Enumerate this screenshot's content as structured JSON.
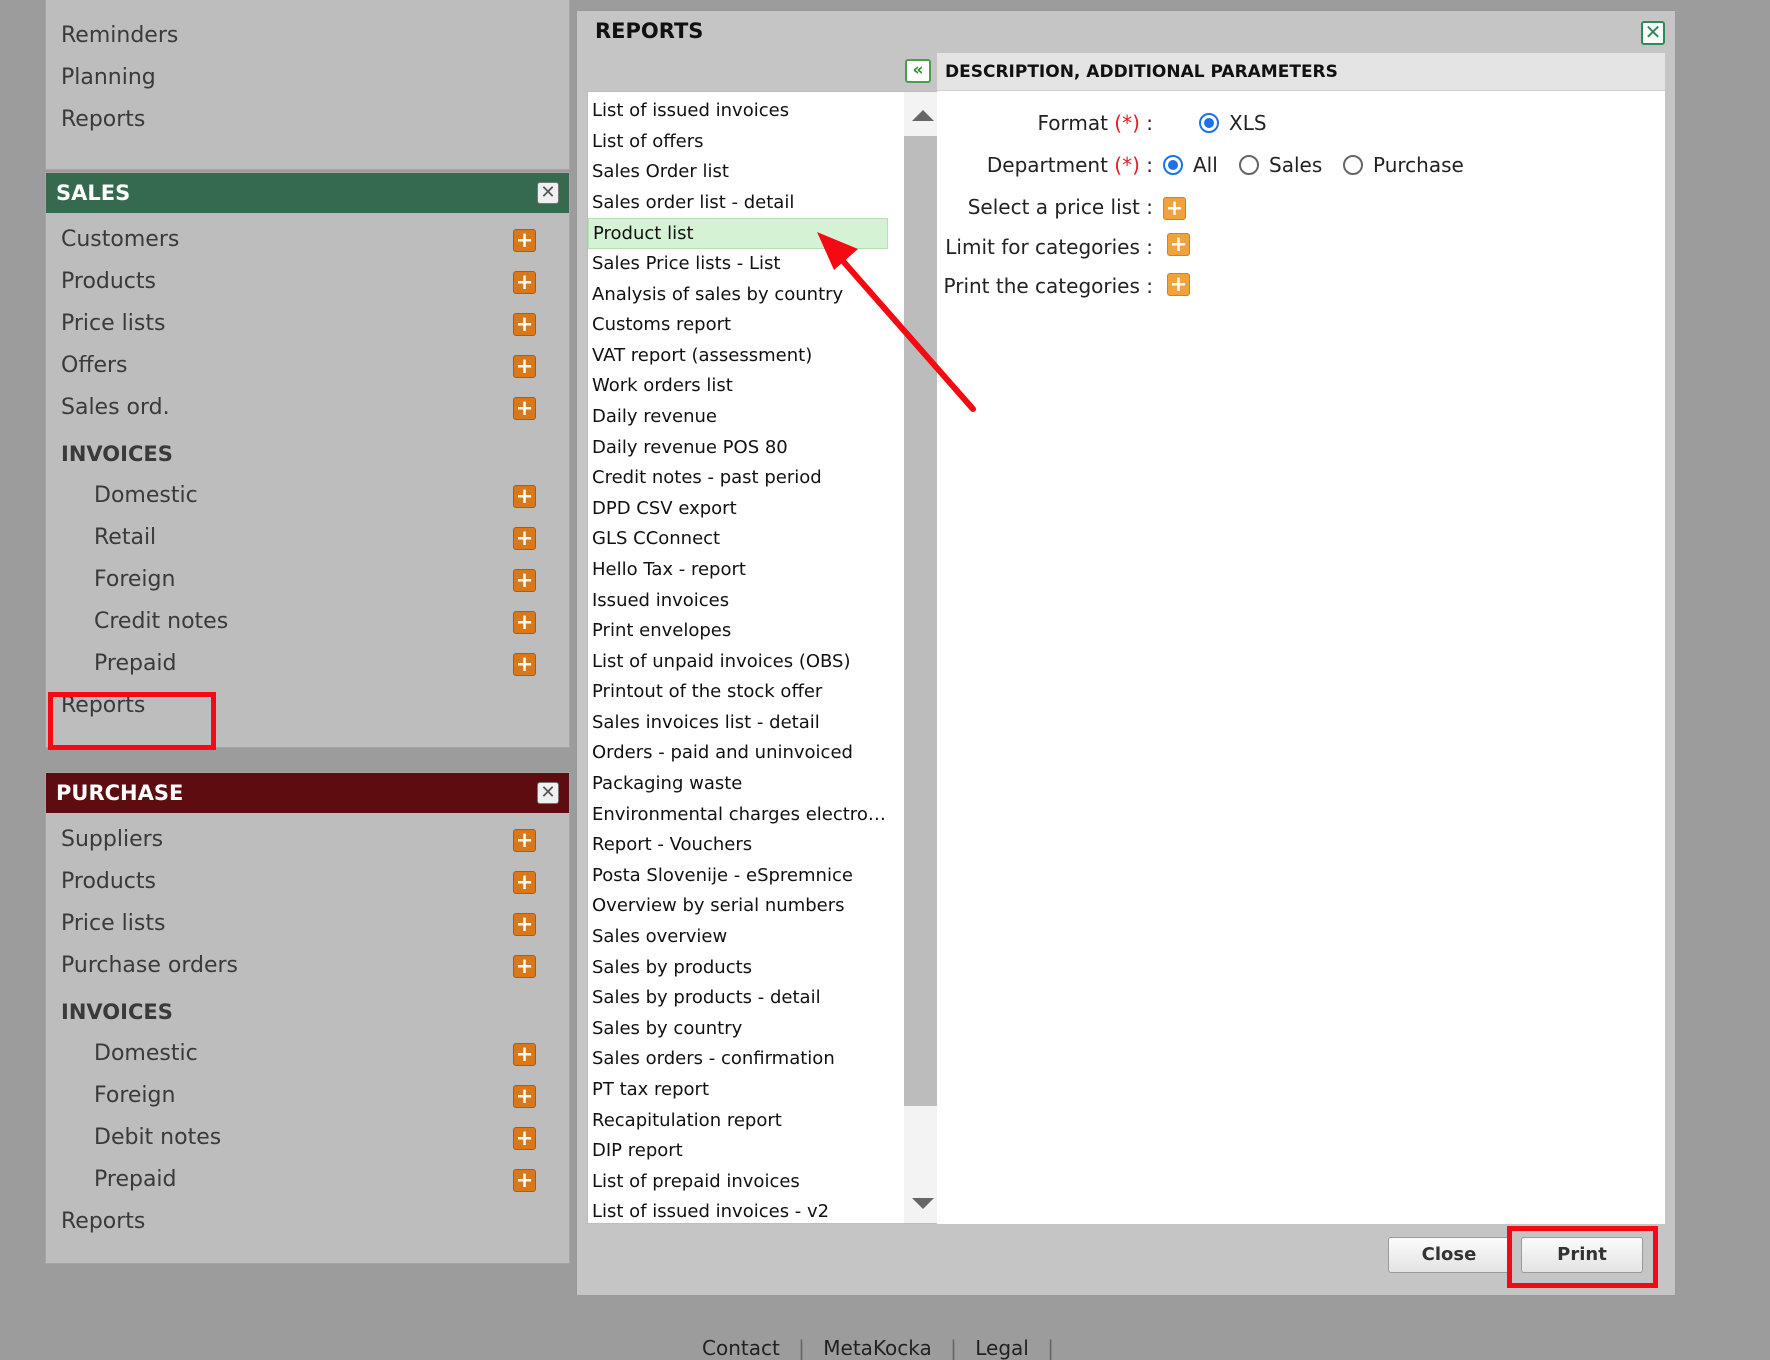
{
  "top_menu": {
    "items": [
      "Reminders",
      "Planning",
      "Reports"
    ]
  },
  "sales": {
    "title": "SALES",
    "items": [
      "Customers",
      "Products",
      "Price lists",
      "Offers",
      "Sales ord."
    ],
    "invoices_heading": "INVOICES",
    "invoices": [
      "Domestic",
      "Retail",
      "Foreign",
      "Credit notes",
      "Prepaid"
    ],
    "reports": "Reports"
  },
  "purchase": {
    "title": "PURCHASE",
    "items": [
      "Suppliers",
      "Products",
      "Price lists",
      "Purchase orders"
    ],
    "invoices_heading": "INVOICES",
    "invoices": [
      "Domestic",
      "Foreign",
      "Debit notes",
      "Prepaid"
    ],
    "reports": "Reports"
  },
  "modal": {
    "title": "REPORTS",
    "desc_header": "DESCRIPTION, ADDITIONAL PARAMETERS",
    "selected_report": "Product list",
    "reports": [
      "List of issued invoices",
      "List of offers",
      "Sales Order list",
      "Sales order list - detail",
      "Product list",
      "Sales Price lists - List",
      "Analysis of sales by country",
      "Customs report",
      "VAT report (assessment)",
      "Work orders list",
      "Daily revenue",
      "Daily revenue POS 80",
      "Credit notes - past period",
      "DPD CSV export",
      "GLS CConnect",
      "Hello Tax - report",
      "Issued invoices",
      "Print envelopes",
      "List of unpaid invoices (OBS)",
      "Printout of the stock offer",
      "Sales invoices list - detail",
      "Orders - paid and uninvoiced",
      "Packaging waste",
      "Environmental charges electronic e...",
      "Report - Vouchers",
      "Posta Slovenije - eSpremnice",
      "Overview by serial numbers",
      "Sales overview",
      "Sales by products",
      "Sales by products - detail",
      "Sales by country",
      "Sales orders - confirmation",
      "PT tax report",
      "Recapitulation report",
      "DIP report",
      "List of prepaid invoices",
      "List of issued invoices - v2"
    ],
    "params": {
      "format_label": "Format",
      "required_mark": "(*)",
      "colon": ":",
      "format_value": "XLS",
      "department_label": "Department",
      "department_options": [
        "All",
        "Sales",
        "Purchase"
      ],
      "department_selected": "All",
      "price_list_label": "Select a price list :",
      "limit_categories_label": "Limit for categories :",
      "print_categories_label": "Print the categories :"
    },
    "close_label": "Close",
    "print_label": "Print"
  },
  "footer": {
    "links": [
      "Contact",
      "MetaKocka",
      "Legal"
    ],
    "separator": "|"
  },
  "colors": {
    "sales_header": "#356a4e",
    "purchase_header": "#5d0d0f",
    "accent": "#d8781b",
    "highlight": "#f50a14"
  }
}
